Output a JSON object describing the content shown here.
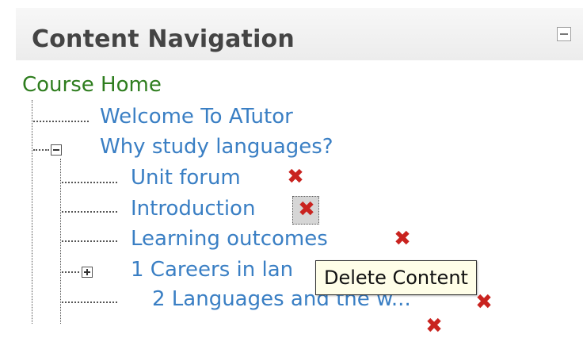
{
  "panel": {
    "title": "Content Navigation",
    "collapse_icon": "collapse-icon"
  },
  "nav": {
    "course_home": "Course Home",
    "items": [
      {
        "label": "Welcome To ATutor"
      },
      {
        "label": "Why study languages?",
        "expanded": true,
        "children": [
          {
            "label": "Unit forum"
          },
          {
            "label": "Introduction"
          },
          {
            "label": "Learning outcomes"
          },
          {
            "label": "1 Careers in lan",
            "collapsed": true
          },
          {
            "label": "2 Languages and the w..."
          }
        ]
      }
    ]
  },
  "tooltip": "Delete Content",
  "colors": {
    "link": "#3a7fc4",
    "home": "#2e7d1e",
    "delete": "#c9231f"
  }
}
